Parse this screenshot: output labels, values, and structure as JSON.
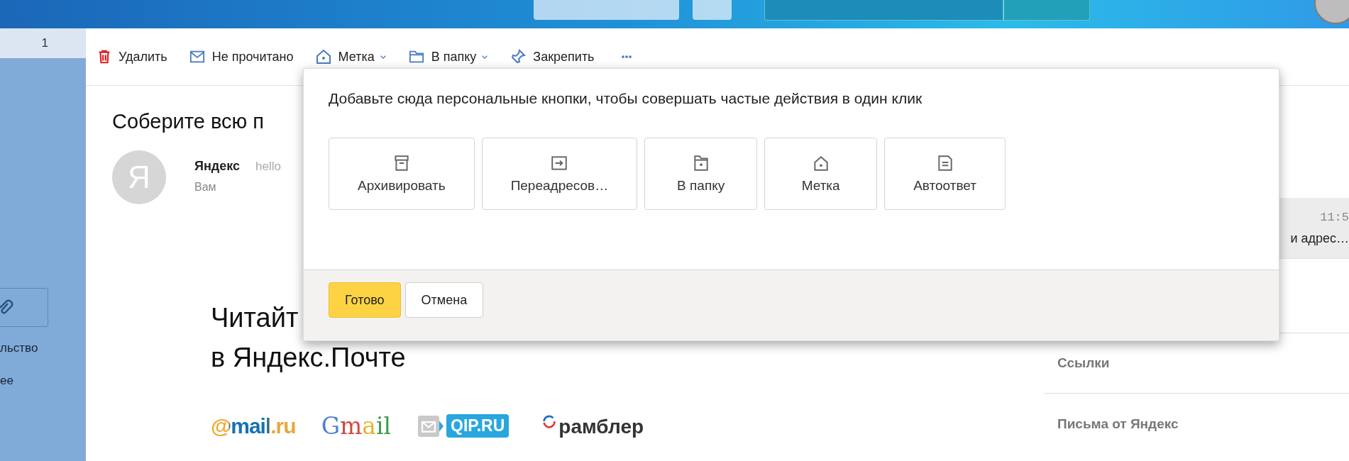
{
  "sidebar": {
    "counter": "1",
    "texts": [
      "льство",
      "ее"
    ]
  },
  "toolbar": [
    {
      "kind": "delete",
      "label": "Удалить",
      "dropdown": false
    },
    {
      "kind": "unread",
      "label": "Не прочитано",
      "dropdown": false
    },
    {
      "kind": "label",
      "label": "Метка",
      "dropdown": true
    },
    {
      "kind": "folder",
      "label": "В папку",
      "dropdown": true
    },
    {
      "kind": "pin",
      "label": "Закрепить",
      "dropdown": false
    },
    {
      "kind": "more"
    }
  ],
  "message": {
    "subject": "Соберите всю п",
    "sender": "Яндекс",
    "sender_email": "hello",
    "recipient": "Вам",
    "avatar_letter": "Я",
    "headline": [
      "Читайт",
      "в Яндекс.Почте"
    ],
    "logos": [
      {
        "kind": "mailru",
        "text": "@mail.ru"
      },
      {
        "kind": "gmail",
        "text": "Gmail"
      },
      {
        "kind": "qip",
        "text": "QIP.RU"
      },
      {
        "kind": "rambler",
        "text": "рамблер"
      }
    ]
  },
  "right_panel": {
    "time": "11:5",
    "snippet": "и адрес…",
    "sections": [
      "Ссылки",
      "Письма от Яндекс"
    ]
  },
  "dialog": {
    "prompt": "Добавьте сюда персональные кнопки, чтобы совершать частые действия в один клик",
    "actions": [
      {
        "kind": "archive",
        "label": "Архивировать"
      },
      {
        "kind": "forward",
        "label": "Переадресов…"
      },
      {
        "kind": "folder",
        "label": "В папку"
      },
      {
        "kind": "label",
        "label": "Метка"
      },
      {
        "kind": "autoreply",
        "label": "Автоответ"
      }
    ],
    "buttons": [
      {
        "kind": "primary",
        "label": "Готово"
      },
      {
        "kind": "secondary",
        "label": "Отмена"
      }
    ]
  }
}
